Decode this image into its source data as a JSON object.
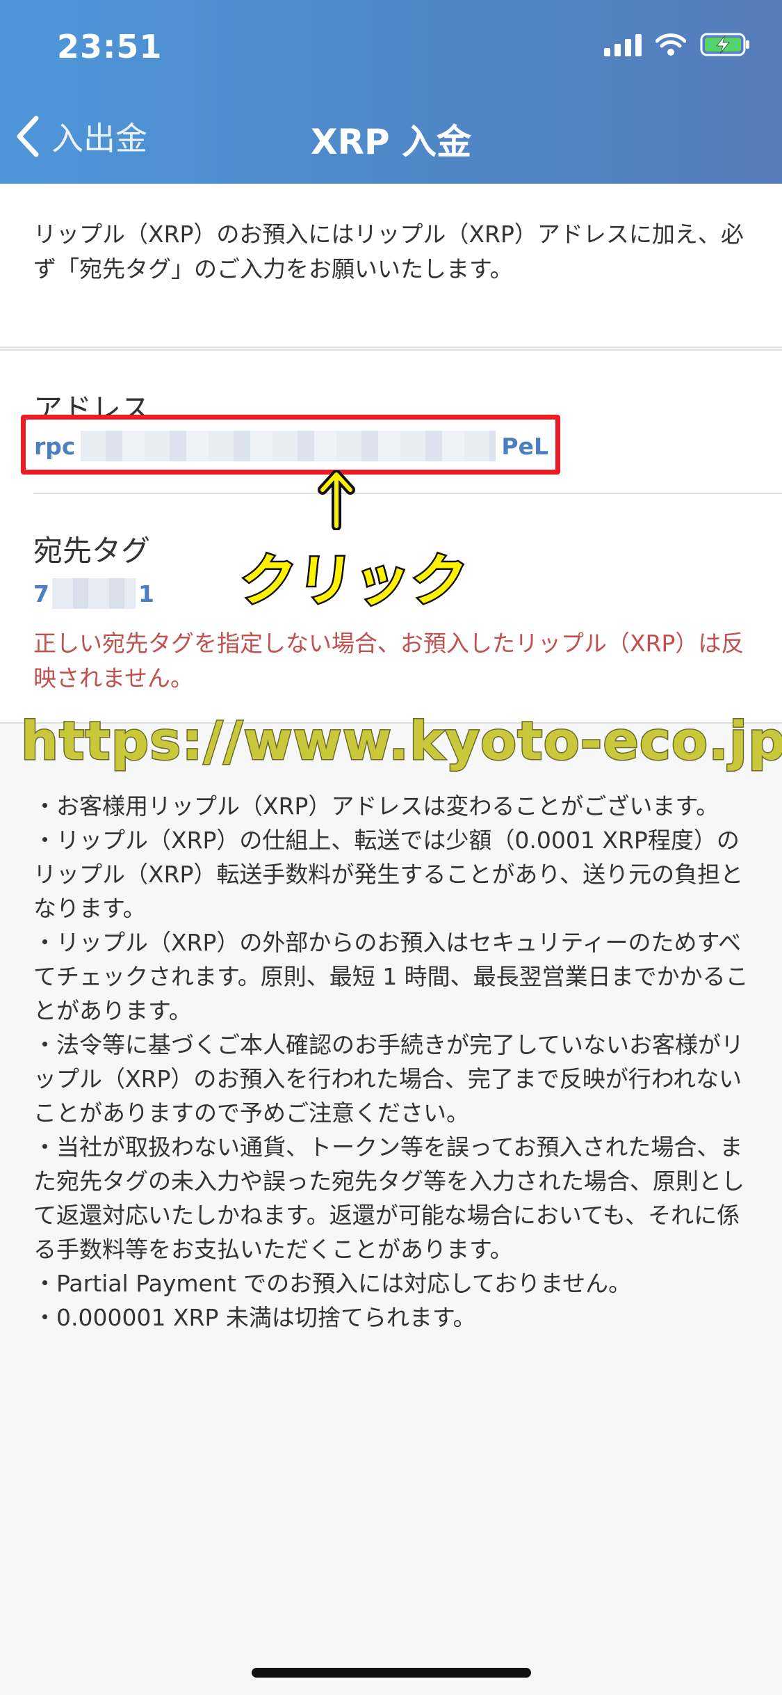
{
  "status_bar": {
    "time": "23:51"
  },
  "nav": {
    "back_label": "入出金",
    "title": "XRP 入金"
  },
  "intro": {
    "text": "リップル（XRP）のお預入にはリップル（XRP）アドレスに加え、必ず「宛先タグ」のご入力をお願いいたします。"
  },
  "address": {
    "label": "アドレス",
    "prefix": "rpc",
    "suffix": "PeL"
  },
  "destination_tag": {
    "label": "宛先タグ",
    "prefix": "7",
    "suffix": "1",
    "warning": "正しい宛先タグを指定しない場合、お預入したリップル（XRP）は反映されません。"
  },
  "annotation": {
    "arrow": "↑",
    "label": "クリック",
    "watermark": "https://www.kyoto-eco.jp/"
  },
  "notes": [
    "・お客様用リップル（XRP）アドレスは変わることがございます。",
    "・リップル（XRP）の仕組上、転送では少額（0.0001 XRP程度）のリップル（XRP）転送手数料が発生することがあり、送り元の負担となります。",
    "・リップル（XRP）の外部からのお預入はセキュリティーのためすべてチェックされます。原則、最短 1 時間、最長翌営業日までかかることがあります。",
    "・法令等に基づくご本人確認のお手続きが完了していないお客様がリップル（XRP）のお預入を行われた場合、完了まで反映が行われないことがありますので予めご注意ください。",
    "・当社が取扱わない通貨、トークン等を誤ってお預入された場合、また宛先タグの未入力や誤った宛先タグ等を入力された場合、原則として返還対応いたしかねます。返還が可能な場合においても、それに係る手数料等をお支払いただくことがあります。",
    "・Partial Payment でのお預入には対応しておりません。",
    "・0.000001 XRP 未満は切捨てられます。"
  ],
  "icons": [
    "chevron-left-icon",
    "signal-icon",
    "wifi-icon",
    "battery-charging-icon"
  ],
  "colors": {
    "header": "#4f86c5",
    "link": "#4a7fc0",
    "warning": "#c0514e",
    "highlight_box": "#ec1c24"
  }
}
